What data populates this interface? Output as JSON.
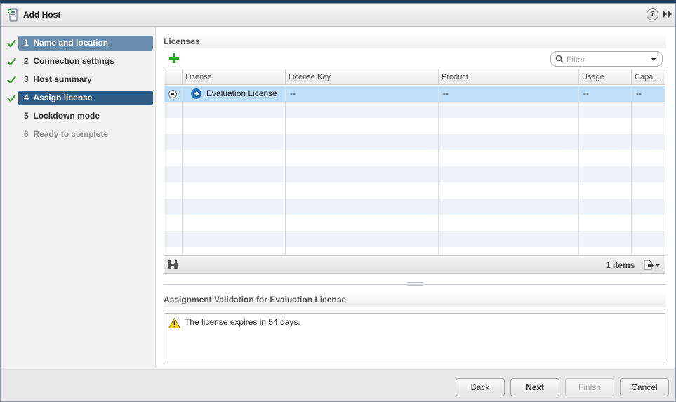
{
  "dialog": {
    "title": "Add Host",
    "help_label": "?"
  },
  "steps": [
    {
      "number": "1",
      "label": "Name and location",
      "state": "completed"
    },
    {
      "number": "2",
      "label": "Connection settings",
      "state": "completed"
    },
    {
      "number": "3",
      "label": "Host summary",
      "state": "completed"
    },
    {
      "number": "4",
      "label": "Assign license",
      "state": "current"
    },
    {
      "number": "5",
      "label": "Lockdown mode",
      "state": "pending"
    },
    {
      "number": "6",
      "label": "Ready to complete",
      "state": "disabled"
    }
  ],
  "licenses": {
    "header": "Licenses",
    "filter_placeholder": "Filter",
    "columns": [
      "License",
      "License Key",
      "Product",
      "Usage",
      "Capa..."
    ],
    "rows": [
      {
        "license": "Evaluation License",
        "key": "--",
        "product": "--",
        "usage": "--",
        "capacity": "--",
        "selected": true
      }
    ],
    "items_count": "1 items"
  },
  "validation": {
    "header": "Assignment Validation for Evaluation License",
    "message": "The license expires in 54 days."
  },
  "buttons": {
    "back": "Back",
    "next": "Next",
    "finish": "Finish",
    "cancel": "Cancel"
  },
  "colors": {
    "selected_step": "#2f5c85",
    "visited_step": "#6a8cad",
    "row_selected": "#bfe0f8",
    "check": "#3a9a2a"
  }
}
